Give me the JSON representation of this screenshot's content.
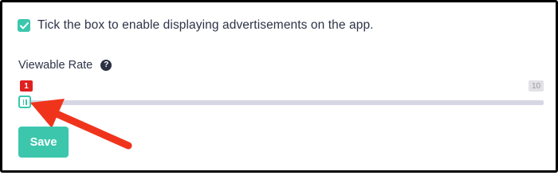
{
  "ads_setting": {
    "checkbox_label": "Tick the box to enable displaying advertisements on the app.",
    "checked": true
  },
  "viewable_rate": {
    "label": "Viewable Rate",
    "help_icon": "question-circle-icon",
    "value": 1,
    "min_label": "1",
    "max_label": "10",
    "min": 1,
    "max": 10
  },
  "actions": {
    "save_label": "Save"
  },
  "annotation": {
    "icon": "red-arrow",
    "color": "#f0341c"
  },
  "colors": {
    "accent": "#3cc7ad",
    "badge_red": "#e02020",
    "text": "#2c3446",
    "track": "#d7d6e4"
  }
}
